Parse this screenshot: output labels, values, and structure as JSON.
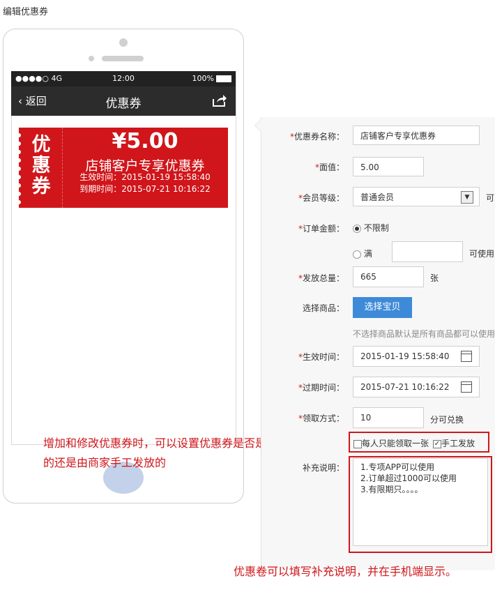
{
  "page_title": "编辑优惠券",
  "phone": {
    "status": {
      "signal": "●●●●○ 4G",
      "time": "12:00",
      "battery": "100%"
    },
    "nav": {
      "back": "返回",
      "title": "优惠券"
    },
    "coupon": {
      "tag_chars": [
        "优",
        "惠",
        "券"
      ],
      "amount": "¥5.00",
      "name": "店铺客户专享优惠券",
      "start": "生效时间：2015-01-19 15:58:40",
      "end": "到期时间：2015-07-21 10:16:22",
      "color": "#d0161b"
    }
  },
  "annotations": {
    "note1": "增加和修改优惠券时，可以设置优惠券是否是自行领取的还是由商家手工发放的",
    "note2": "优惠卷可以填写补充说明，并在手机端显示。"
  },
  "form": {
    "name": {
      "label": "优惠券名称：",
      "value": "店铺客户专享优惠券"
    },
    "face_value": {
      "label": "面值：",
      "value": "5.00"
    },
    "member_level": {
      "label": "会员等级：",
      "value": "普通会员",
      "trailing": "可"
    },
    "order_amount": {
      "label": "订单金额：",
      "option_unlimited": "不限制",
      "option_over": "满",
      "over_value": "",
      "over_suffix": "可使用"
    },
    "total_issue": {
      "label": "发放总量：",
      "value": "665",
      "unit": "张"
    },
    "products": {
      "label": "选择商品：",
      "button": "选择宝贝",
      "hint": "不选择商品默认是所有商品都可以使用"
    },
    "start_time": {
      "label": "生效时间：",
      "value": "2015-01-19 15:58:40"
    },
    "end_time": {
      "label": "过期时间：",
      "value": "2015-07-21 10:16:22"
    },
    "claim_method": {
      "label": "领取方式：",
      "value": "10",
      "suffix": "分可兑换",
      "limit_one": "每人只能领取一张",
      "manual": "手工发放",
      "limit_one_checked": false,
      "manual_checked": true
    },
    "description": {
      "label": "补充说明：",
      "lines": [
        "1.专项APP可以使用",
        "2.订单超过1000可以使用",
        "3.有限期只。。。。"
      ]
    }
  }
}
